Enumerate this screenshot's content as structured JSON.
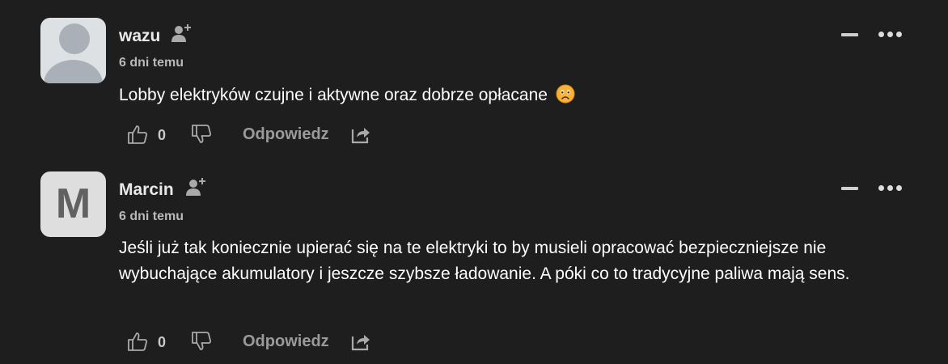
{
  "comments": [
    {
      "username": "wazu",
      "time": "6 dni temu",
      "text": "Lobby elektryków czujne i aktywne oraz dobrze opłacane",
      "emoji": "frowning-face",
      "avatar": "default-silhouette",
      "likes": "0",
      "reply_label": "Odpowiedz"
    },
    {
      "username": "Marcin",
      "time": "6 dni temu",
      "text": "Jeśli już tak koniecznie upierać się na te elektryki to by musieli opracować bezpieczniejsze nie wybuchające akumulatory i jeszcze szybsze ładowanie. A póki co to tradycyjne paliwa mają sens.",
      "avatar_letter": "M",
      "likes": "0",
      "reply_label": "Odpowiedz"
    }
  ],
  "colors": {
    "background": "#1f1e1f",
    "text": "#ffffff",
    "muted": "#9a9a9a",
    "icon": "#aaaaaa"
  },
  "icons": [
    "follow-user-icon",
    "minimize-icon",
    "more-options-icon",
    "thumbs-up-icon",
    "thumbs-down-icon",
    "share-icon"
  ]
}
